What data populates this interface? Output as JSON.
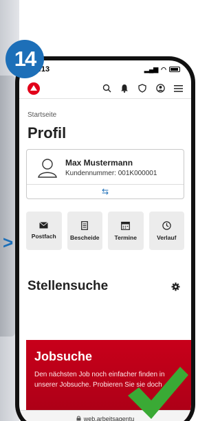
{
  "step_number": "14",
  "status_bar": {
    "time": "09:13"
  },
  "header": {
    "icons": [
      "search-icon",
      "bell-icon",
      "shield-icon",
      "user-icon",
      "menu-icon"
    ]
  },
  "breadcrumb": "Startseite",
  "page_title": "Profil",
  "profile": {
    "name": "Max Mustermann",
    "customer_number": "Kundennummer: 001K000001",
    "switch_icon": "⇆"
  },
  "quick_links": [
    {
      "label": "Postfach",
      "icon": "envelope-icon"
    },
    {
      "label": "Bescheide",
      "icon": "document-icon"
    },
    {
      "label": "Termine",
      "icon": "calendar-icon"
    },
    {
      "label": "Verlauf",
      "icon": "clock-icon"
    }
  ],
  "section_title": "Stellensuche",
  "promo": {
    "title": "Jobsuche",
    "text": "Den nächsten Job noch einfacher finden in unserer Jobsuche. Probieren Sie sie doch"
  },
  "url": "web.arbeitsagentu",
  "colors": {
    "accent": "#e2001a",
    "badge": "#1d6fb8",
    "check": "#3aaa35"
  }
}
